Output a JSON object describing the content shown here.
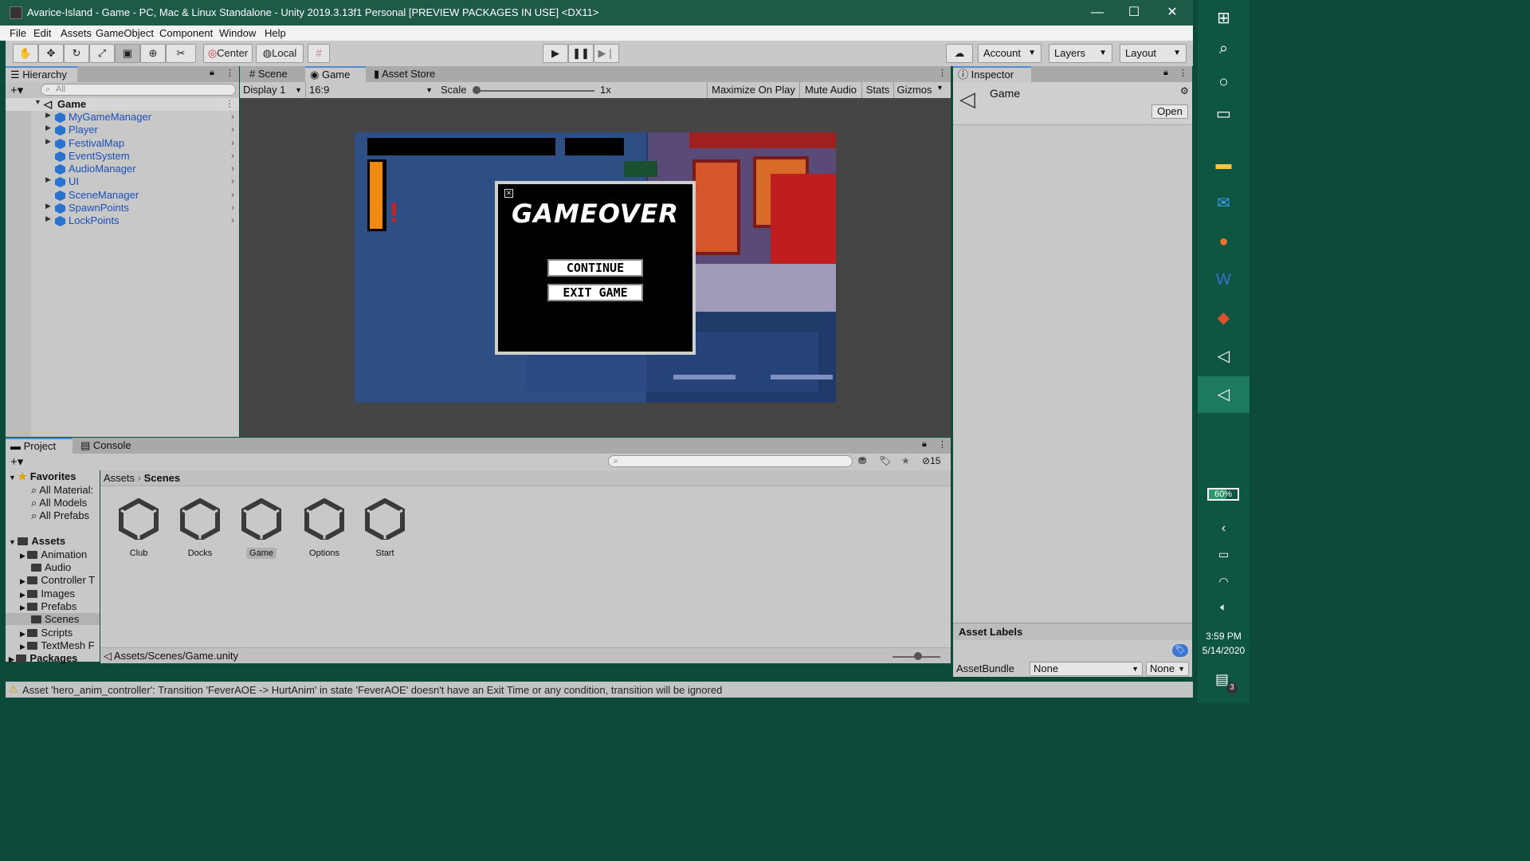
{
  "window": {
    "title": "Avarice-Island - Game - PC, Mac & Linux Standalone - Unity 2019.3.13f1 Personal [PREVIEW PACKAGES IN USE] <DX11>",
    "minimize": "—",
    "maximize": "☐",
    "close": "✕"
  },
  "menu": [
    "File",
    "Edit",
    "Assets",
    "GameObject",
    "Component",
    "Window",
    "Help"
  ],
  "toolbar": {
    "pivot": "Center",
    "space": "Local",
    "account": "Account",
    "layers": "Layers",
    "layout": "Layout"
  },
  "hierarchy": {
    "tab": "Hierarchy",
    "search_placeholder": "All",
    "scene": "Game",
    "items": [
      "MyGameManager",
      "Player",
      "FestivalMap",
      "EventSystem",
      "AudioManager",
      "UI",
      "SceneManager",
      "SpawnPoints",
      "LockPoints"
    ]
  },
  "game_view": {
    "tabs": [
      "Scene",
      "Game",
      "Asset Store"
    ],
    "display": "Display 1",
    "aspect": "16:9",
    "scale_label": "Scale",
    "scale_value": "1x",
    "maximize_on_play": "Maximize On Play",
    "mute_audio": "Mute Audio",
    "stats": "Stats",
    "gizmos": "Gizmos",
    "dialog": {
      "title": "GAMEOVER",
      "continue": "CONTINUE",
      "exit": "EXIT GAME"
    }
  },
  "inspector": {
    "tab": "Inspector",
    "object": "Game",
    "open": "Open",
    "asset_labels": "Asset Labels",
    "asset_bundle": "AssetBundle",
    "bundle_value": "None",
    "variant_value": "None"
  },
  "project": {
    "tabs": [
      "Project",
      "Console"
    ],
    "hidden_count": "15",
    "breadcrumb": [
      "Assets",
      "Scenes"
    ],
    "favorites_label": "Favorites",
    "favorites": [
      "All Material:",
      "All Models",
      "All Prefabs"
    ],
    "assets_label": "Assets",
    "folders": [
      "Animation",
      "Audio",
      "Controller T",
      "Images",
      "Prefabs",
      "Scenes",
      "Scripts",
      "TextMesh F"
    ],
    "packages_label": "Packages",
    "files": [
      "Club",
      "Docks",
      "Game",
      "Options",
      "Start"
    ],
    "path": "Assets/Scenes/Game.unity"
  },
  "status": "Asset 'hero_anim_controller': Transition 'FeverAOE -> HurtAnim' in state 'FeverAOE' doesn't have an Exit Time or any condition, transition will be ignored",
  "taskbar": {
    "battery": "60%",
    "time": "3:59 PM",
    "date": "5/14/2020",
    "notifications": "3"
  }
}
